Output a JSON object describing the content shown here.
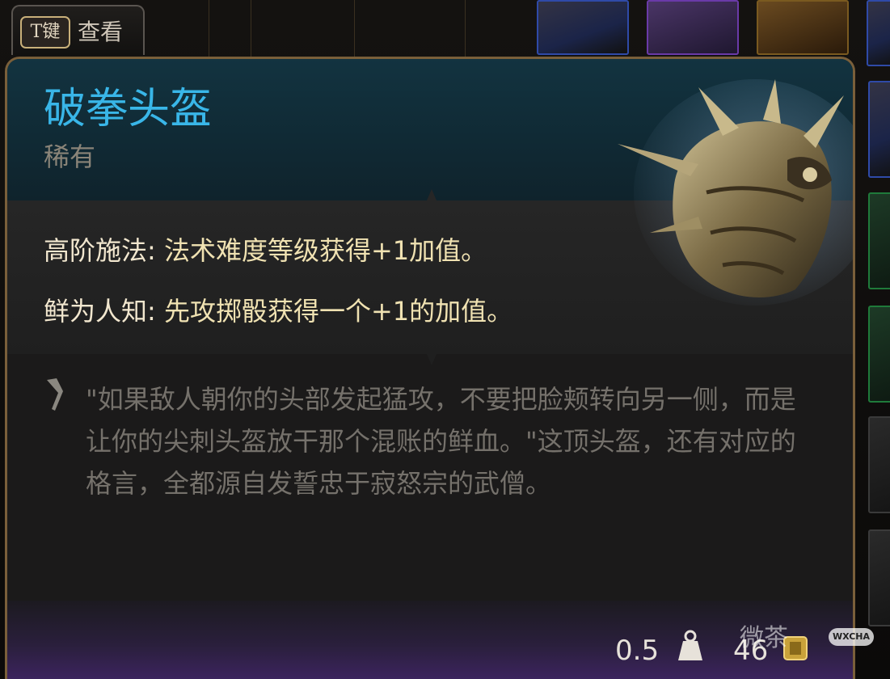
{
  "hint": {
    "key": "T键",
    "label": "查看"
  },
  "item": {
    "name": "破拳头盔",
    "rarity": "稀有",
    "properties": [
      {
        "name": "高阶施法:",
        "desc": "法术难度等级获得+1加值。"
      },
      {
        "name": "鲜为人知:",
        "desc": "先攻掷骰获得一个+1的加值。"
      }
    ],
    "lore": "\"如果敌人朝你的头部发起猛攻，不要把脸颊转向另一侧，而是让你的尖刺头盔放干那个混账的鲜血。\"这顶头盔，还有对应的格言，全都源自发誓忠于寂怒宗的武僧。",
    "weight": "0.5",
    "price": "46"
  },
  "watermark": {
    "text": "微茶",
    "badge": "WXCHA"
  },
  "colors": {
    "title": "#39b6e8",
    "rarity": "#8a8478",
    "property": "#f0e2b2",
    "lore": "#75716b",
    "frame": "#7a5f3a"
  },
  "icons": [
    "quote-mark-icon",
    "weight-icon",
    "gold-coin-icon",
    "helmet-image"
  ]
}
